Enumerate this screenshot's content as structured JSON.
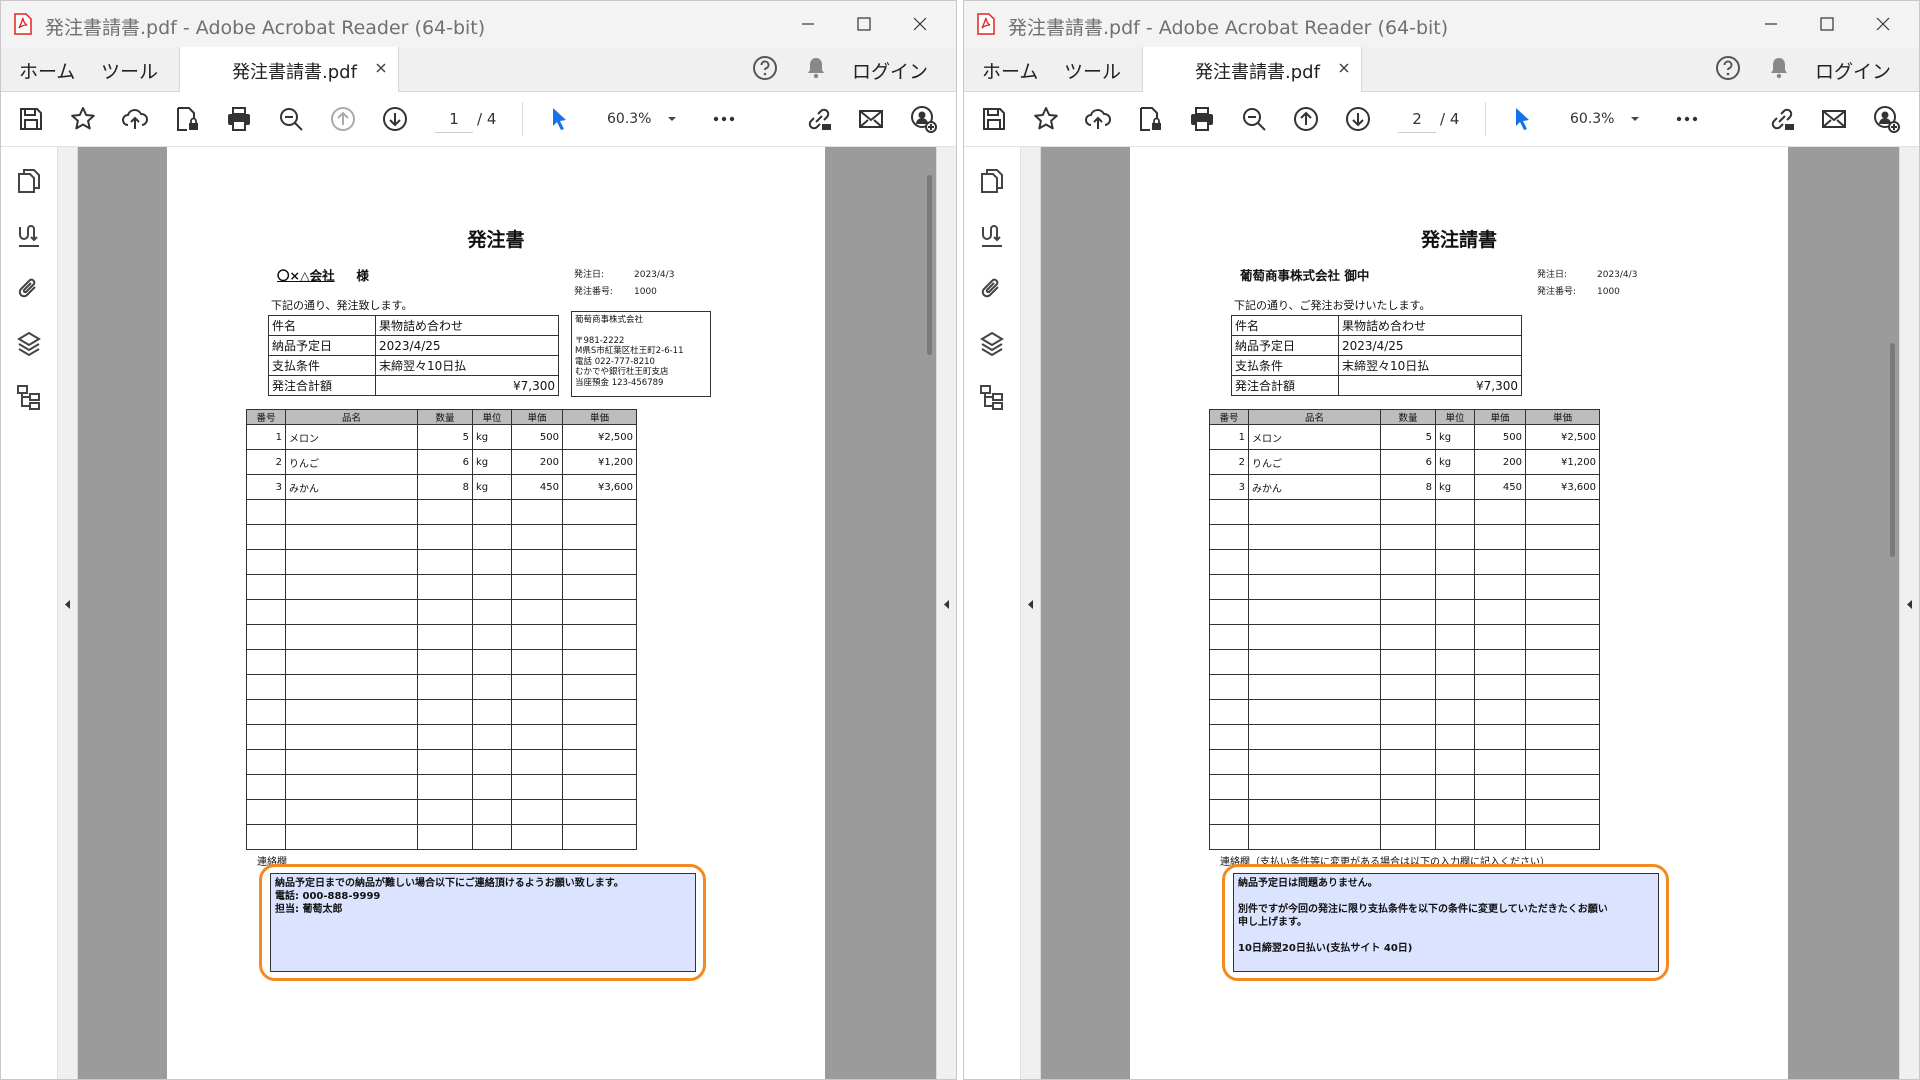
{
  "app": {
    "title_suffix": " - Adobe Acrobat Reader (64-bit)",
    "nav_home": "ホーム",
    "nav_tools": "ツール",
    "login": "ログイン"
  },
  "colors": {
    "accent": "#1473e6",
    "highlight_ring": "#f28a1f",
    "contact_box_bg": "#dbe3ff",
    "pdf_red": "#e1251b"
  },
  "icons": {
    "toolbar": [
      "save-icon",
      "star-icon",
      "cloud-upload-icon",
      "file-lock-icon",
      "print-icon",
      "zoom-out-search-icon",
      "arrow-up-circle-icon",
      "arrow-down-circle-icon",
      "select-cursor-icon",
      "more-icon",
      "link-icon",
      "mail-icon",
      "add-user-icon"
    ],
    "rail": [
      "pages-icon",
      "signature-icon",
      "attachment-icon",
      "layers-icon",
      "structure-icon"
    ]
  },
  "left": {
    "file_name": "発注書請書.pdf",
    "window_title": "発注書請書.pdf - Adobe Acrobat Reader (64-bit)",
    "page_current": "1",
    "page_total": "/ 4",
    "zoom": "60.3%",
    "document": {
      "title": "発注書",
      "recipient_name": "〇×△会社",
      "recipient_suffix": "様",
      "order_date_label": "発注日:",
      "order_date": "2023/4/3",
      "order_no_label": "発注番号:",
      "order_no": "1000",
      "intro": "下記の通り、発注致します。",
      "info": [
        {
          "label": "件名",
          "value": "果物詰め合わせ"
        },
        {
          "label": "納品予定日",
          "value": "2023/4/25"
        },
        {
          "label": "支払条件",
          "value": "末締翌々10日払"
        },
        {
          "label": "発注合計額",
          "value": "¥7,300"
        }
      ],
      "company": {
        "name": "葡萄商事株式会社",
        "postal": "〒981-2222",
        "address": "M県S市紅葉区杜王町2-6-11",
        "phone": "電話 022-777-8210",
        "bank": "むかでや銀行杜王町支店",
        "account": "当座預金 123-456789"
      },
      "headers": [
        "番号",
        "品名",
        "数量",
        "単位",
        "単価",
        "単価"
      ],
      "items": [
        {
          "no": "1",
          "name": "メロン",
          "qty": "5",
          "unit": "kg",
          "price": "500",
          "amount": "¥2,500"
        },
        {
          "no": "2",
          "name": "りんご",
          "qty": "6",
          "unit": "kg",
          "price": "200",
          "amount": "¥1,200"
        },
        {
          "no": "3",
          "name": "みかん",
          "qty": "8",
          "unit": "kg",
          "price": "450",
          "amount": "¥3,600"
        }
      ],
      "contact_label": "連絡欄",
      "contact_lines": [
        "納品予定日までの納品が難しい場合以下にご連絡頂けるようお願い致します。",
        "電話:  000-888-9999",
        "担当:  葡萄太郎"
      ]
    }
  },
  "right": {
    "file_name": "発注書請書.pdf",
    "window_title": "発注書請書.pdf - Adobe Acrobat Reader (64-bit)",
    "page_current": "2",
    "page_total": "/ 4",
    "zoom": "60.3%",
    "document": {
      "title": "発注請書",
      "recipient_name": "葡萄商事株式会社 御中",
      "order_date_label": "発注日:",
      "order_date": "2023/4/3",
      "order_no_label": "発注番号:",
      "order_no": "1000",
      "intro": "下記の通り、ご発注お受けいたします。",
      "info": [
        {
          "label": "件名",
          "value": "果物詰め合わせ"
        },
        {
          "label": "納品予定日",
          "value": "2023/4/25"
        },
        {
          "label": "支払条件",
          "value": "末締翌々10日払"
        },
        {
          "label": "発注合計額",
          "value": "¥7,300"
        }
      ],
      "headers": [
        "番号",
        "品名",
        "数量",
        "単位",
        "単価",
        "単価"
      ],
      "items": [
        {
          "no": "1",
          "name": "メロン",
          "qty": "5",
          "unit": "kg",
          "price": "500",
          "amount": "¥2,500"
        },
        {
          "no": "2",
          "name": "りんご",
          "qty": "6",
          "unit": "kg",
          "price": "200",
          "amount": "¥1,200"
        },
        {
          "no": "3",
          "name": "みかん",
          "qty": "8",
          "unit": "kg",
          "price": "450",
          "amount": "¥3,600"
        }
      ],
      "contact_label": "連絡欄（支払い条件等に変更がある場合は以下の入力欄に記入ください）",
      "contact_lines": [
        "納品予定日は問題ありません。",
        "",
        "別件ですが今回の発注に限り支払条件を以下の条件に変更していただきたくお願い",
        "申し上げます。",
        "",
        "10日締翌20日払い(支払サイト 40日)"
      ]
    }
  }
}
